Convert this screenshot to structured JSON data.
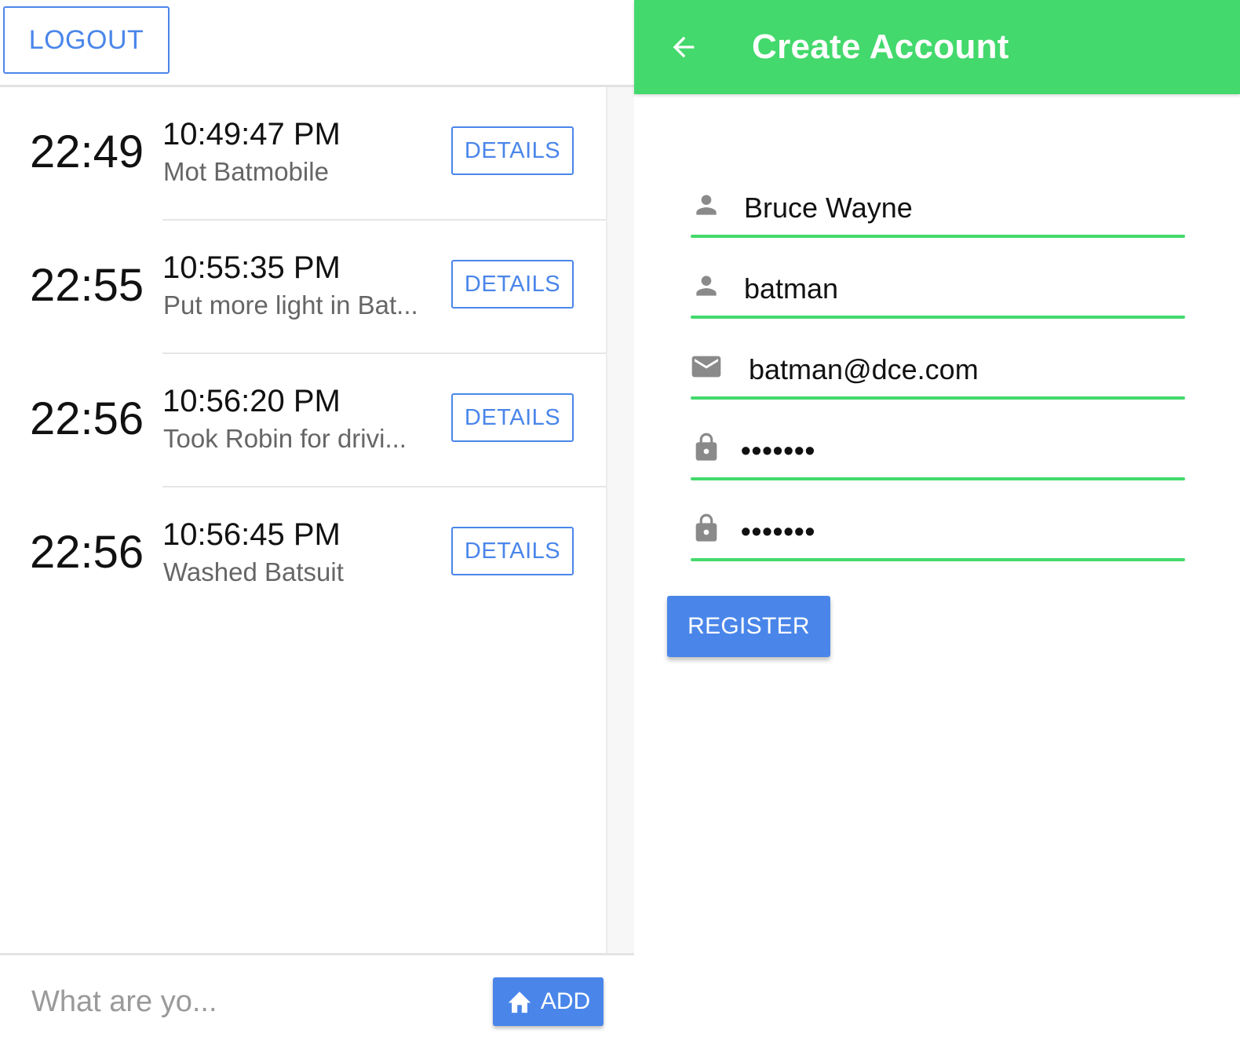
{
  "left": {
    "logout_label": "LOGOUT",
    "entries": [
      {
        "time": "22:49",
        "timestamp": "10:49:47 PM",
        "description": "Mot Batmobile",
        "details_label": "DETAILS"
      },
      {
        "time": "22:55",
        "timestamp": "10:55:35 PM",
        "description": "Put more light in Bat...",
        "details_label": "DETAILS"
      },
      {
        "time": "22:56",
        "timestamp": "10:56:20 PM",
        "description": "Took Robin for drivi...",
        "details_label": "DETAILS"
      },
      {
        "time": "22:56",
        "timestamp": "10:56:45 PM",
        "description": "Washed Batsuit",
        "details_label": "DETAILS"
      }
    ],
    "input_placeholder": "What are yo...",
    "add_label": "ADD",
    "add_icon": "home-icon"
  },
  "right": {
    "title": "Create Account",
    "back_icon": "arrow-left-icon",
    "fields": [
      {
        "icon": "person-icon",
        "value": "Bruce Wayne"
      },
      {
        "icon": "person-icon",
        "value": "batman"
      },
      {
        "icon": "mail-icon",
        "value": "batman@dce.com"
      },
      {
        "icon": "lock-icon",
        "value": "•••••••"
      },
      {
        "icon": "lock-icon",
        "value": "•••••••"
      }
    ],
    "register_label": "REGISTER"
  },
  "colors": {
    "accent_blue": "#4a86ea",
    "app_green": "#43d96c"
  }
}
